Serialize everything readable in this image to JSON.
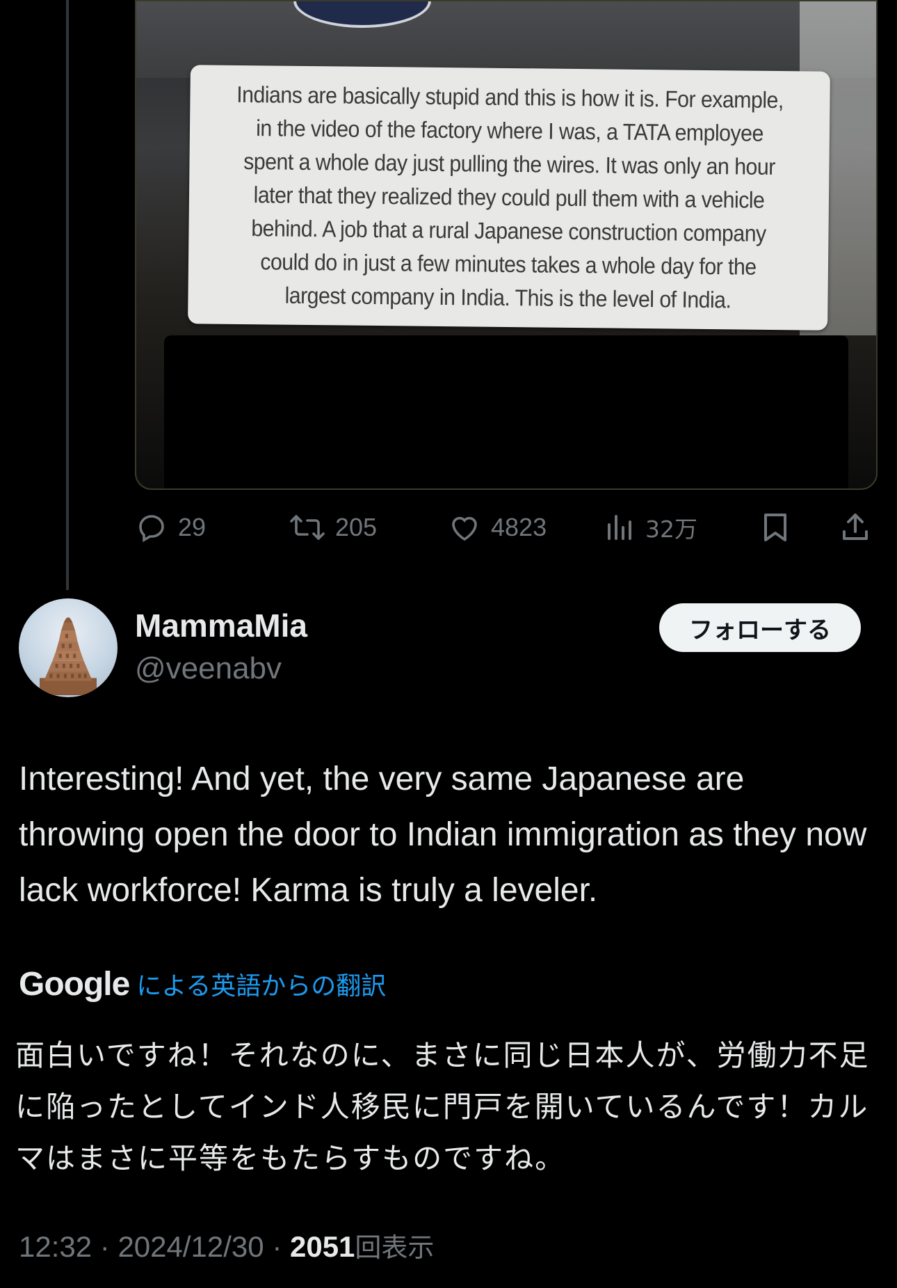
{
  "media": {
    "caption": "Indians are basically stupid and this is how it is. For example, in the video of the factory where I was, a TATA employee spent a whole day just pulling the wires. It was only an hour later that they realized they could pull them with a vehicle behind. A job that a rural Japanese construction company could do in just a few minutes takes a whole day for the largest company in India. This is the level of India."
  },
  "actions": {
    "replies": "29",
    "retweets": "205",
    "likes": "4823",
    "views": "32万",
    "icons": [
      "reply-icon",
      "retweet-icon",
      "like-icon",
      "views-icon",
      "bookmark-icon",
      "share-icon"
    ]
  },
  "reply": {
    "display_name": "MammaMia",
    "handle": "@veenabv",
    "follow_label": "フォローする",
    "text": "Interesting! And yet, the very same Japanese are throwing open the door to Indian immigration as they now lack workforce! Karma is truly a leveler.",
    "translation_provider": "Google",
    "translation_label": "による英語からの翻訳",
    "translated_text": "面白いですね！それなのに、まさに同じ日本人が、労働力不足に陥ったとしてインド人移民に門戸を開いているんです！カルマはまさに平等をもたらすものですね。",
    "time": "12:32",
    "date": "2024/12/30",
    "view_count": "2051",
    "view_label": "回表示"
  },
  "colors": {
    "background": "#000000",
    "text_primary": "#e7e9ea",
    "text_secondary": "#71767b",
    "accent": "#1d9bf0",
    "follow_button_bg": "#eff3f4"
  }
}
